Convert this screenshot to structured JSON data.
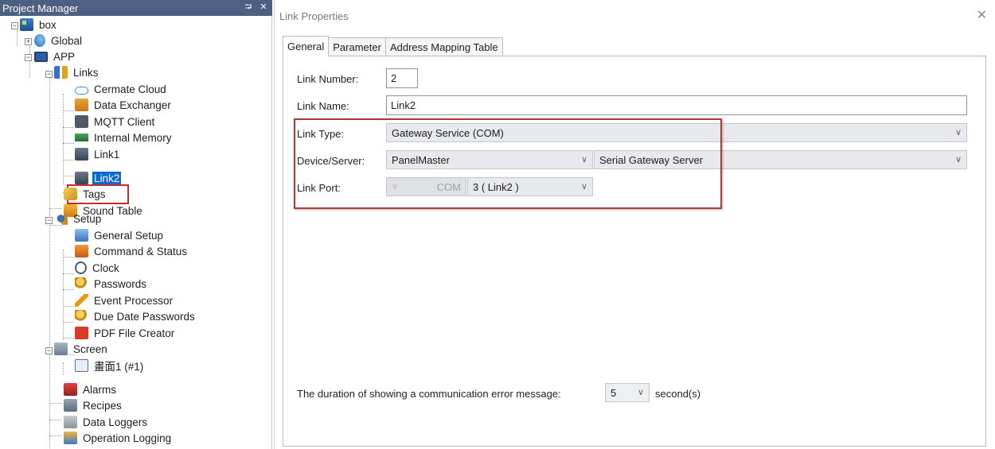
{
  "project_manager": {
    "title": "Project Manager",
    "pin_glyph": "⮒",
    "close_glyph": "✕",
    "tree": {
      "box": "box",
      "global": "Global",
      "app": "APP",
      "links": "Links",
      "cermate_cloud": "Cermate Cloud",
      "data_exchanger": "Data Exchanger",
      "mqtt_client": "MQTT Client",
      "internal_memory": "Internal Memory",
      "link1": "Link1",
      "link2": "Link2",
      "tags": "Tags",
      "sound_table": "Sound Table",
      "setup": "Setup",
      "general_setup": "General Setup",
      "command_status": "Command & Status",
      "clock": "Clock",
      "passwords": "Passwords",
      "event_processor": "Event Processor",
      "due_date_passwords": "Due Date Passwords",
      "pdf_file_creator": "PDF File Creator",
      "screen": "Screen",
      "screen1": "畫面1 (#1)",
      "alarms": "Alarms",
      "recipes": "Recipes",
      "data_loggers": "Data Loggers",
      "operation_logging": "Operation Logging"
    },
    "selected_item": "Link2"
  },
  "dialog": {
    "title": "Link Properties",
    "close_glyph": "✕",
    "tabs": [
      "General",
      "Parameter",
      "Address Mapping Table"
    ],
    "active_tab": "General",
    "link_number_label": "Link Number:",
    "link_number_value": "2",
    "link_name_label": "Link Name:",
    "link_name_value": "Link2",
    "link_type_label": "Link Type:",
    "link_type_value": "Gateway Service (COM)",
    "device_server_label": "Device/Server:",
    "device_value": "PanelMaster",
    "server_value": "Serial Gateway Server",
    "link_port_label": "Link Port:",
    "link_port_prefix": "COM",
    "link_port_value": "3 ( Link2 )",
    "dropdown_glyph": "∨",
    "error_duration_label": "The duration of showing a communication error message:",
    "error_duration_value": "5",
    "error_duration_unit": "second(s)"
  },
  "colors": {
    "pm_title_bg": "#4d6082",
    "selection_bg": "#0b69d0",
    "highlight_border": "#b53535"
  }
}
